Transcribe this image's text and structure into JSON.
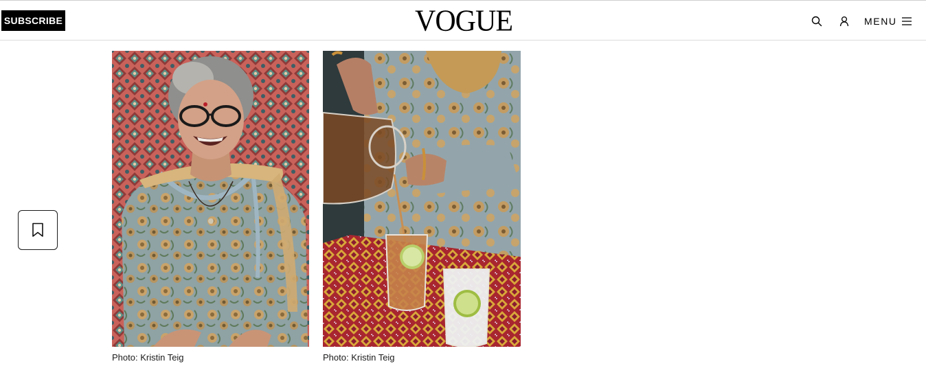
{
  "header": {
    "subscribe_label": "SUBSCRIBE",
    "logo_text": "VOGUE",
    "search_icon": "search-icon",
    "account_icon": "user-icon",
    "menu_label": "MENU",
    "menu_icon": "hamburger-icon"
  },
  "sidebar": {
    "bookmark_icon": "bookmark-icon"
  },
  "gallery": {
    "images": [
      {
        "caption": "Photo: Kristin Teig",
        "subject": "woman-portrait"
      },
      {
        "caption": "Photo: Kristin Teig",
        "subject": "pouring-drink"
      }
    ]
  },
  "colors": {
    "brand_black": "#000000",
    "background": "#ffffff"
  }
}
